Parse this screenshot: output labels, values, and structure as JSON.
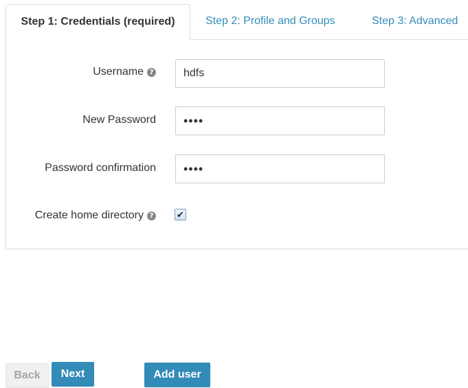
{
  "tabs": [
    {
      "label": "Step 1: Credentials (required)",
      "active": true
    },
    {
      "label": "Step 2: Profile and Groups",
      "active": false
    },
    {
      "label": "Step 3: Advanced",
      "active": false
    }
  ],
  "form": {
    "username": {
      "label": "Username",
      "value": "hdfs",
      "help_icon": "question-circle-icon"
    },
    "new_password": {
      "label": "New Password",
      "value": "••••"
    },
    "password_confirmation": {
      "label": "Password confirmation",
      "value": "••••"
    },
    "create_home_directory": {
      "label": "Create home directory",
      "checked": true,
      "check_glyph": "✔",
      "help_icon": "question-circle-icon"
    }
  },
  "help_glyph": "?",
  "buttons": {
    "back": "Back",
    "next": "Next",
    "add_user": "Add user"
  },
  "colors": {
    "link": "#338bb8",
    "primary_button": "#338bb8",
    "disabled_button": "#f0f0f0",
    "border": "#dddddd"
  }
}
